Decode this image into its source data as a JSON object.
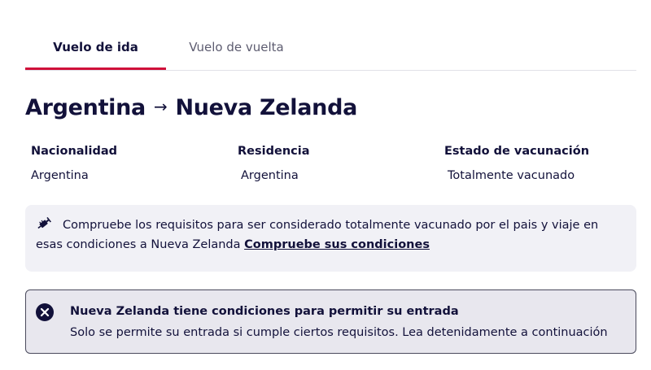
{
  "tabs": {
    "outbound": "Vuelo de ida",
    "return": "Vuelo de vuelta",
    "active": "outbound"
  },
  "route": {
    "origin": "Argentina",
    "arrow": "→",
    "destination": "Nueva Zelanda"
  },
  "traveler": {
    "nationality_label": "Nacionalidad",
    "nationality_value": "Argentina",
    "residence_label": "Residencia",
    "residence_value": "Argentina",
    "vaccination_label": "Estado de vacunación",
    "vaccination_value": "Totalmente vacunado"
  },
  "info": {
    "icon": "syringe-icon",
    "text": "Compruebe los requisitos para ser considerado totalmente vacunado por el pais y viaje en esas condiciones a Nueva Zelanda",
    "link": "Compruebe sus condiciones"
  },
  "alert": {
    "icon": "close-circle-icon",
    "title": "Nueva Zelanda tiene condiciones para permitir su entrada",
    "text": "Solo se permite su entrada si cumple ciertos requisitos. Lea detenidamente a continuación"
  },
  "colors": {
    "accent": "#d0103a",
    "text": "#12113a",
    "info_bg": "#f1f1f6",
    "alert_bg": "#e8e7ee"
  }
}
